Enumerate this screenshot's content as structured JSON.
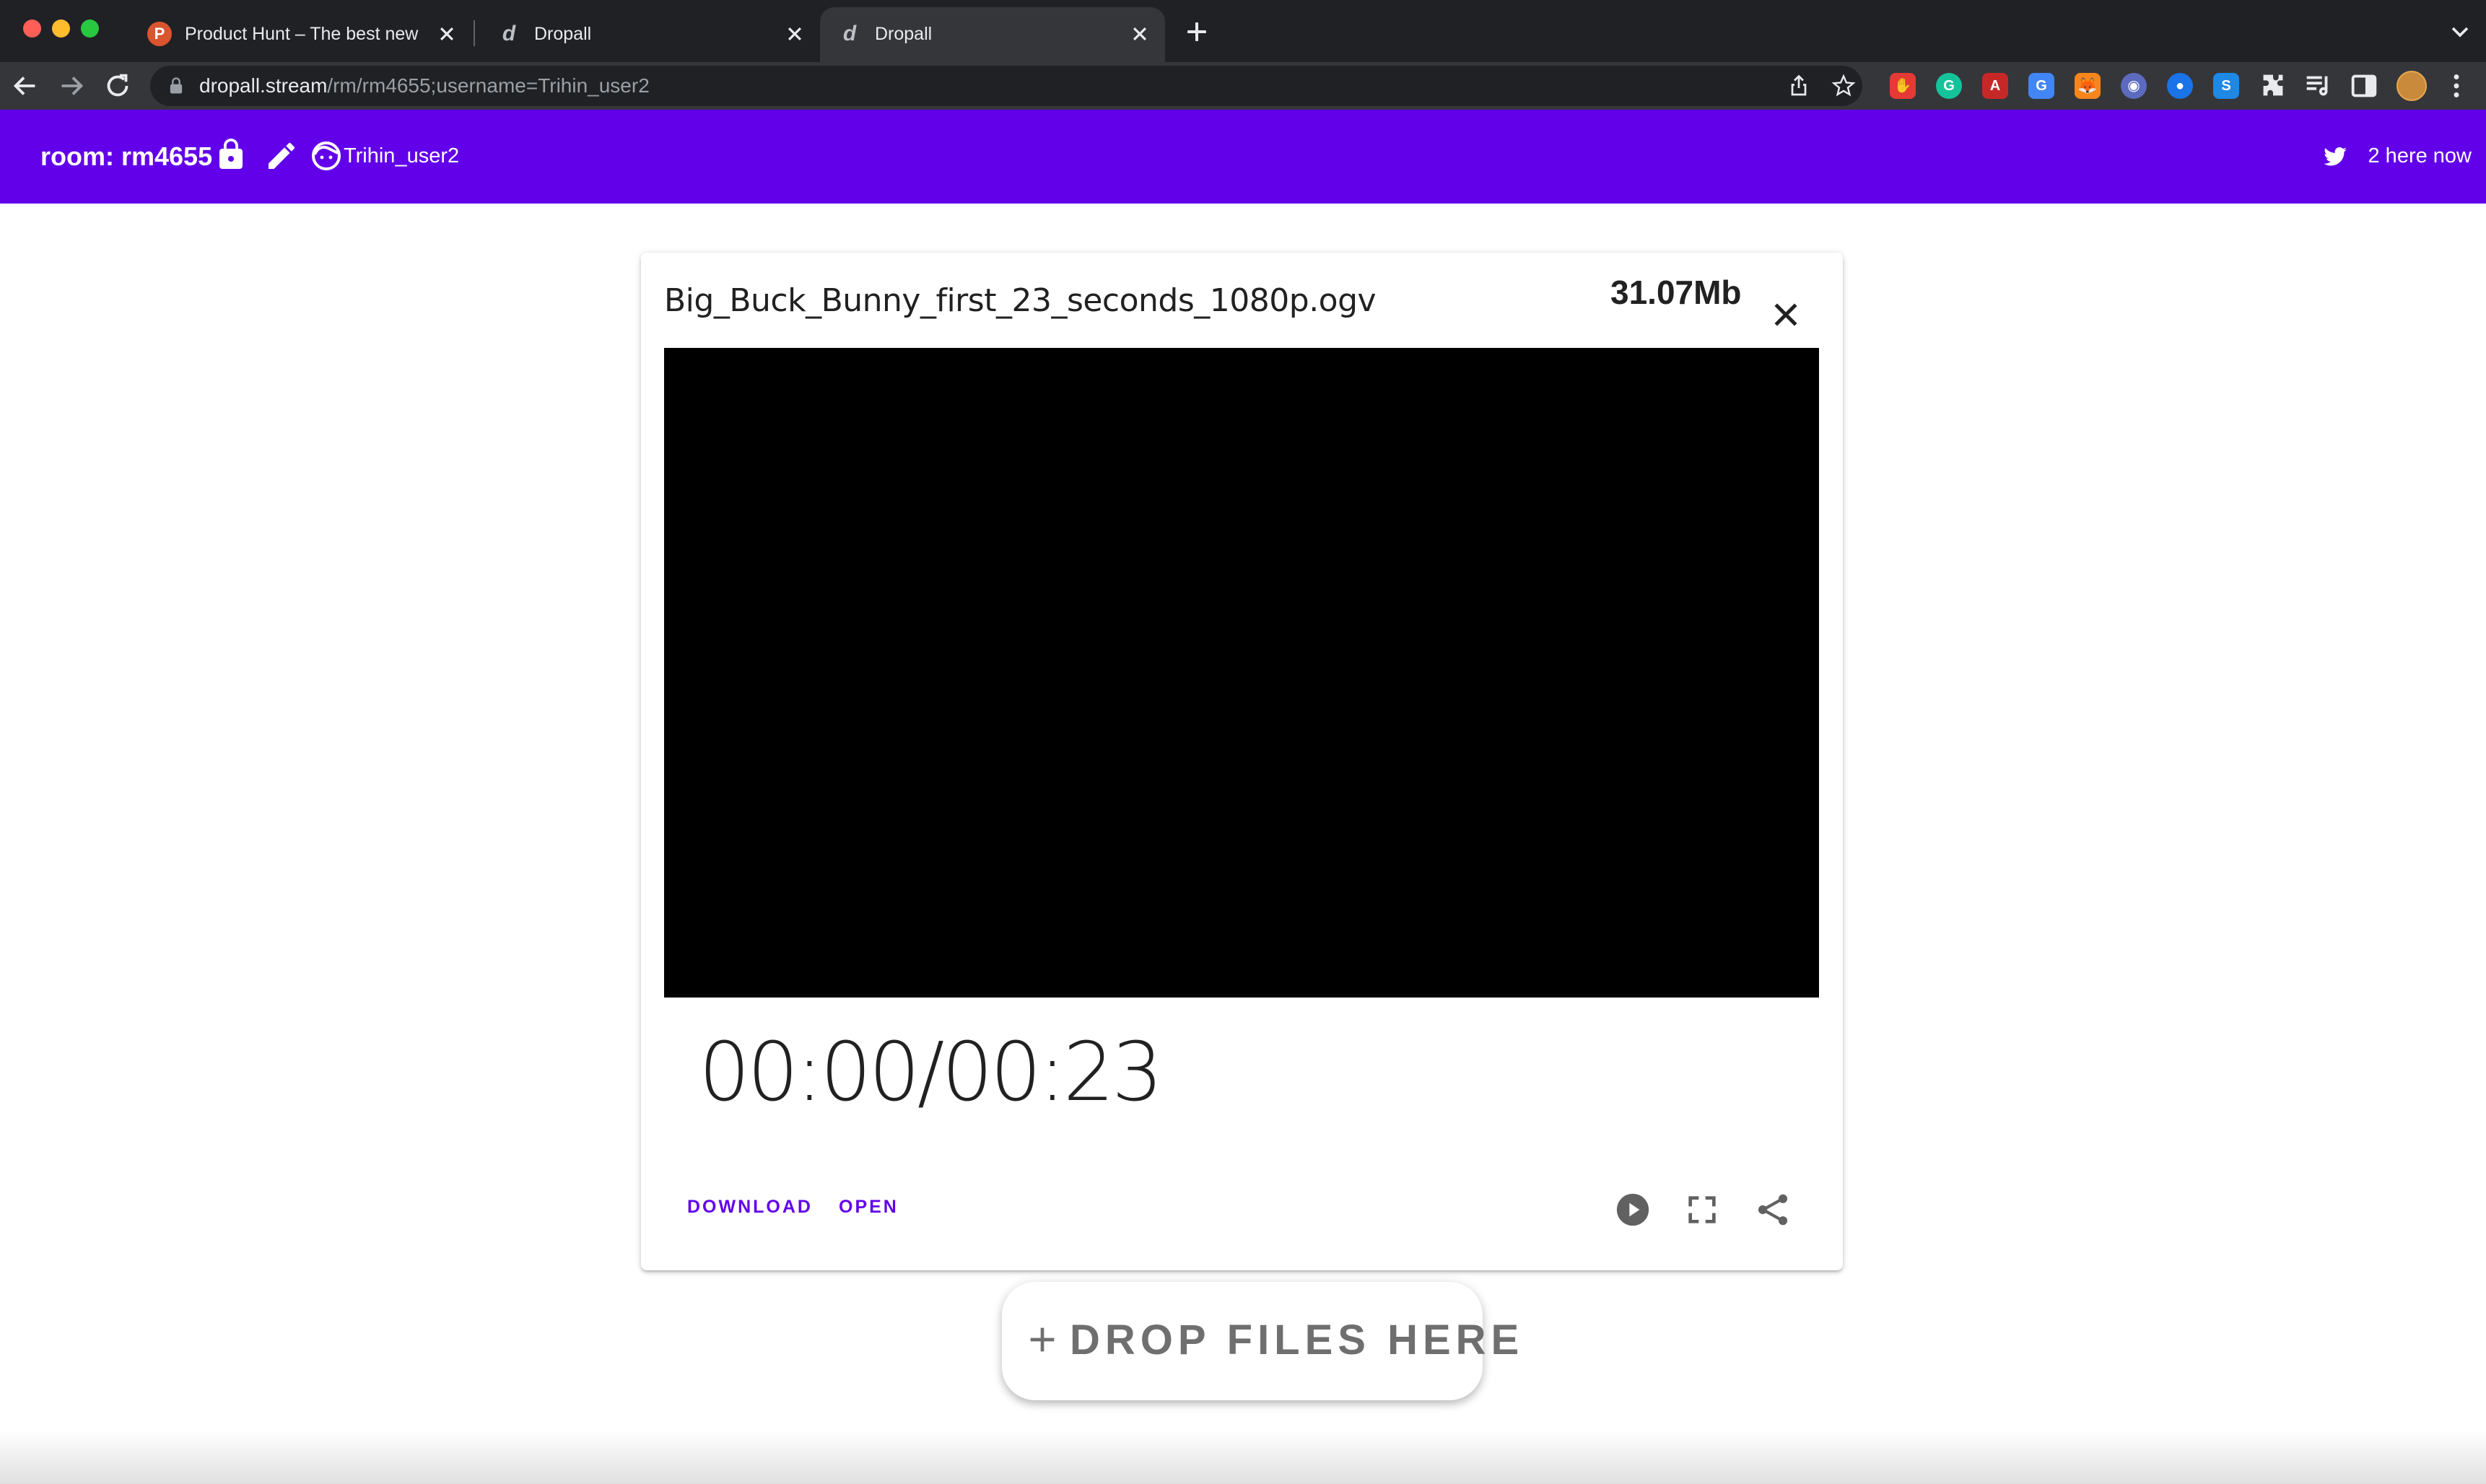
{
  "browser": {
    "tabs": [
      {
        "title": "Product Hunt – The best new p",
        "favicon": "product-hunt-logo",
        "favicon_letter": "P",
        "active": false
      },
      {
        "title": "Dropall",
        "favicon": "dropall-logo",
        "favicon_letter": "d",
        "active": false
      },
      {
        "title": "Dropall",
        "favicon": "dropall-logo",
        "favicon_letter": "d",
        "active": true
      }
    ],
    "url_host": "dropall.stream",
    "url_path": "/rm/rm4655;username=Trihin_user2",
    "extensions": [
      {
        "name": "red-extension-icon",
        "color": "#e53935",
        "glyph": "✋"
      },
      {
        "name": "grammarly-icon",
        "color": "#15c39a",
        "glyph": "G"
      },
      {
        "name": "pdf-extension-icon",
        "color": "#c62828",
        "glyph": "A"
      },
      {
        "name": "translate-extension-icon",
        "color": "#4285f4",
        "glyph": "G"
      },
      {
        "name": "metamask-icon",
        "color": "#f6851b",
        "glyph": "🦊"
      },
      {
        "name": "chat-extension-icon",
        "color": "#5c6bc0",
        "glyph": "◉"
      },
      {
        "name": "circle-extension-icon",
        "color": "#1a73e8",
        "glyph": "●"
      },
      {
        "name": "s-extension-icon",
        "color": "#1e88e5",
        "glyph": "S"
      }
    ]
  },
  "header": {
    "room_label": "room: rm4655",
    "username": "Trihin_user2",
    "presence": "2 here now",
    "accent_color": "#6200ea"
  },
  "file": {
    "name": "Big_Buck_Bunny_first_23_seconds_1080p.ogv",
    "size": "31.07Mb",
    "time": "00:00/00:23",
    "download_label": "DOWNLOAD",
    "open_label": "OPEN"
  },
  "drop": {
    "label": "DROP FILES HERE"
  }
}
